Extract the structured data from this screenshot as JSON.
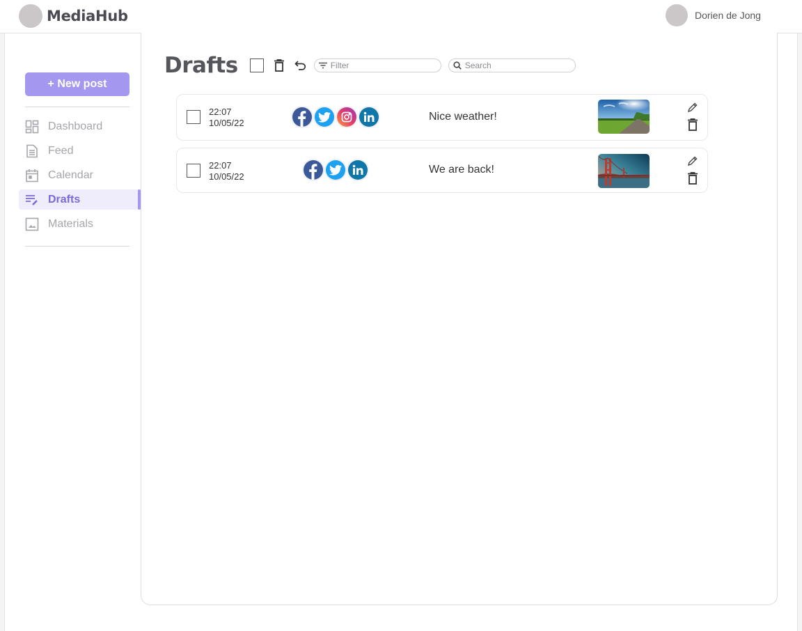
{
  "app": {
    "name": "MediaHub",
    "user_name": "Dorien de Jong"
  },
  "sidebar": {
    "new_post_label": "+ New post",
    "items": [
      {
        "label": "Dashboard",
        "icon": "dashboard-icon",
        "active": false
      },
      {
        "label": "Feed",
        "icon": "feed-icon",
        "active": false
      },
      {
        "label": "Calendar",
        "icon": "calendar-icon",
        "active": false
      },
      {
        "label": "Drafts",
        "icon": "drafts-icon",
        "active": true
      },
      {
        "label": "Materials",
        "icon": "image-icon",
        "active": false
      }
    ]
  },
  "main": {
    "title": "Drafts",
    "filter_placeholder": "Filter",
    "search_placeholder": "Search",
    "posts": [
      {
        "time": "22:07",
        "date": "10/05/22",
        "platforms": [
          "facebook",
          "twitter",
          "instagram",
          "linkedin"
        ],
        "text": "Nice weather!",
        "image": "sunny-road-thumbnail"
      },
      {
        "time": "22:07",
        "date": "10/05/22",
        "platforms": [
          "facebook",
          "twitter",
          "linkedin"
        ],
        "text": "We are back!",
        "image": "golden-gate-bridge-thumbnail"
      }
    ]
  },
  "colors": {
    "accent": "#a397f0",
    "accent_text": "#7a6ad8",
    "active_bg": "#efedfb",
    "facebook": "#3b5998",
    "twitter": "#1da1f2",
    "linkedin": "#0e76a8"
  }
}
